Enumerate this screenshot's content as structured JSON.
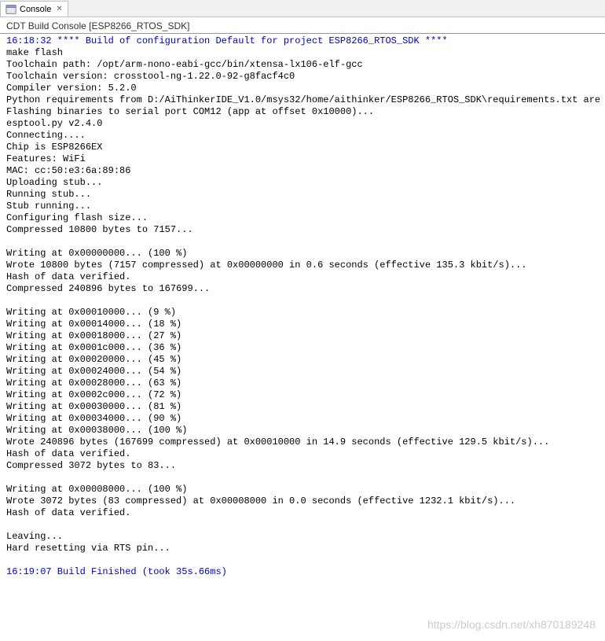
{
  "tab": {
    "label": "Console",
    "close_symbol": "✕"
  },
  "subtitle": "CDT Build Console [ESP8266_RTOS_SDK]",
  "lines": [
    {
      "text": "16:18:32 **** Build of configuration Default for project ESP8266_RTOS_SDK ****",
      "cls": "blue-line"
    },
    {
      "text": "make flash",
      "cls": ""
    },
    {
      "text": "Toolchain path: /opt/arm-nono-eabi-gcc/bin/xtensa-lx106-elf-gcc",
      "cls": ""
    },
    {
      "text": "Toolchain version: crosstool-ng-1.22.0-92-g8facf4c0",
      "cls": ""
    },
    {
      "text": "Compiler version: 5.2.0",
      "cls": ""
    },
    {
      "text": "Python requirements from D:/AiThinkerIDE_V1.0/msys32/home/aithinker/ESP8266_RTOS_SDK\\requirements.txt are",
      "cls": ""
    },
    {
      "text": "Flashing binaries to serial port COM12 (app at offset 0x10000)...",
      "cls": ""
    },
    {
      "text": "esptool.py v2.4.0",
      "cls": ""
    },
    {
      "text": "Connecting....",
      "cls": ""
    },
    {
      "text": "Chip is ESP8266EX",
      "cls": ""
    },
    {
      "text": "Features: WiFi",
      "cls": ""
    },
    {
      "text": "MAC: cc:50:e3:6a:89:86",
      "cls": ""
    },
    {
      "text": "Uploading stub...",
      "cls": ""
    },
    {
      "text": "Running stub...",
      "cls": ""
    },
    {
      "text": "Stub running...",
      "cls": ""
    },
    {
      "text": "Configuring flash size...",
      "cls": ""
    },
    {
      "text": "Compressed 10800 bytes to 7157...",
      "cls": ""
    },
    {
      "text": "",
      "cls": ""
    },
    {
      "text": "Writing at 0x00000000... (100 %)",
      "cls": ""
    },
    {
      "text": "Wrote 10800 bytes (7157 compressed) at 0x00000000 in 0.6 seconds (effective 135.3 kbit/s)...",
      "cls": ""
    },
    {
      "text": "Hash of data verified.",
      "cls": ""
    },
    {
      "text": "Compressed 240896 bytes to 167699...",
      "cls": ""
    },
    {
      "text": "",
      "cls": ""
    },
    {
      "text": "Writing at 0x00010000... (9 %)",
      "cls": ""
    },
    {
      "text": "Writing at 0x00014000... (18 %)",
      "cls": ""
    },
    {
      "text": "Writing at 0x00018000... (27 %)",
      "cls": ""
    },
    {
      "text": "Writing at 0x0001c000... (36 %)",
      "cls": ""
    },
    {
      "text": "Writing at 0x00020000... (45 %)",
      "cls": ""
    },
    {
      "text": "Writing at 0x00024000... (54 %)",
      "cls": ""
    },
    {
      "text": "Writing at 0x00028000... (63 %)",
      "cls": ""
    },
    {
      "text": "Writing at 0x0002c000... (72 %)",
      "cls": ""
    },
    {
      "text": "Writing at 0x00030000... (81 %)",
      "cls": ""
    },
    {
      "text": "Writing at 0x00034000... (90 %)",
      "cls": ""
    },
    {
      "text": "Writing at 0x00038000... (100 %)",
      "cls": ""
    },
    {
      "text": "Wrote 240896 bytes (167699 compressed) at 0x00010000 in 14.9 seconds (effective 129.5 kbit/s)...",
      "cls": ""
    },
    {
      "text": "Hash of data verified.",
      "cls": ""
    },
    {
      "text": "Compressed 3072 bytes to 83...",
      "cls": ""
    },
    {
      "text": "",
      "cls": ""
    },
    {
      "text": "Writing at 0x00008000... (100 %)",
      "cls": ""
    },
    {
      "text": "Wrote 3072 bytes (83 compressed) at 0x00008000 in 0.0 seconds (effective 1232.1 kbit/s)...",
      "cls": ""
    },
    {
      "text": "Hash of data verified.",
      "cls": ""
    },
    {
      "text": "",
      "cls": ""
    },
    {
      "text": "Leaving...",
      "cls": ""
    },
    {
      "text": "Hard resetting via RTS pin...",
      "cls": ""
    },
    {
      "text": "",
      "cls": ""
    },
    {
      "text": "16:19:07 Build Finished (took 35s.66ms)",
      "cls": "blue-line"
    },
    {
      "text": "",
      "cls": ""
    }
  ],
  "watermark": "https://blog.csdn.net/xh870189248"
}
